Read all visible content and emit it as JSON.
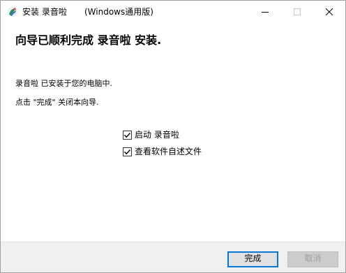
{
  "window": {
    "title": "安装 录音啦",
    "title_suffix": "(Windows通用版)",
    "controls": {
      "minimize": "minimize-icon",
      "maximize": "maximize-icon",
      "close": "close-icon"
    }
  },
  "main": {
    "heading": "向导已顺利完成 录音啦 安装.",
    "paragraph1": "录音啦 已安装于您的电脑中.",
    "paragraph2": "点击 \"完成\" 关闭本向导."
  },
  "options": [
    {
      "label": "启动 录音啦",
      "checked": true
    },
    {
      "label": "查看软件自述文件",
      "checked": true
    }
  ],
  "footer": {
    "finish_label": "完成",
    "cancel_label": "取消"
  },
  "colors": {
    "accent": "#0078d7",
    "footer_bg": "#f0f0f0"
  }
}
